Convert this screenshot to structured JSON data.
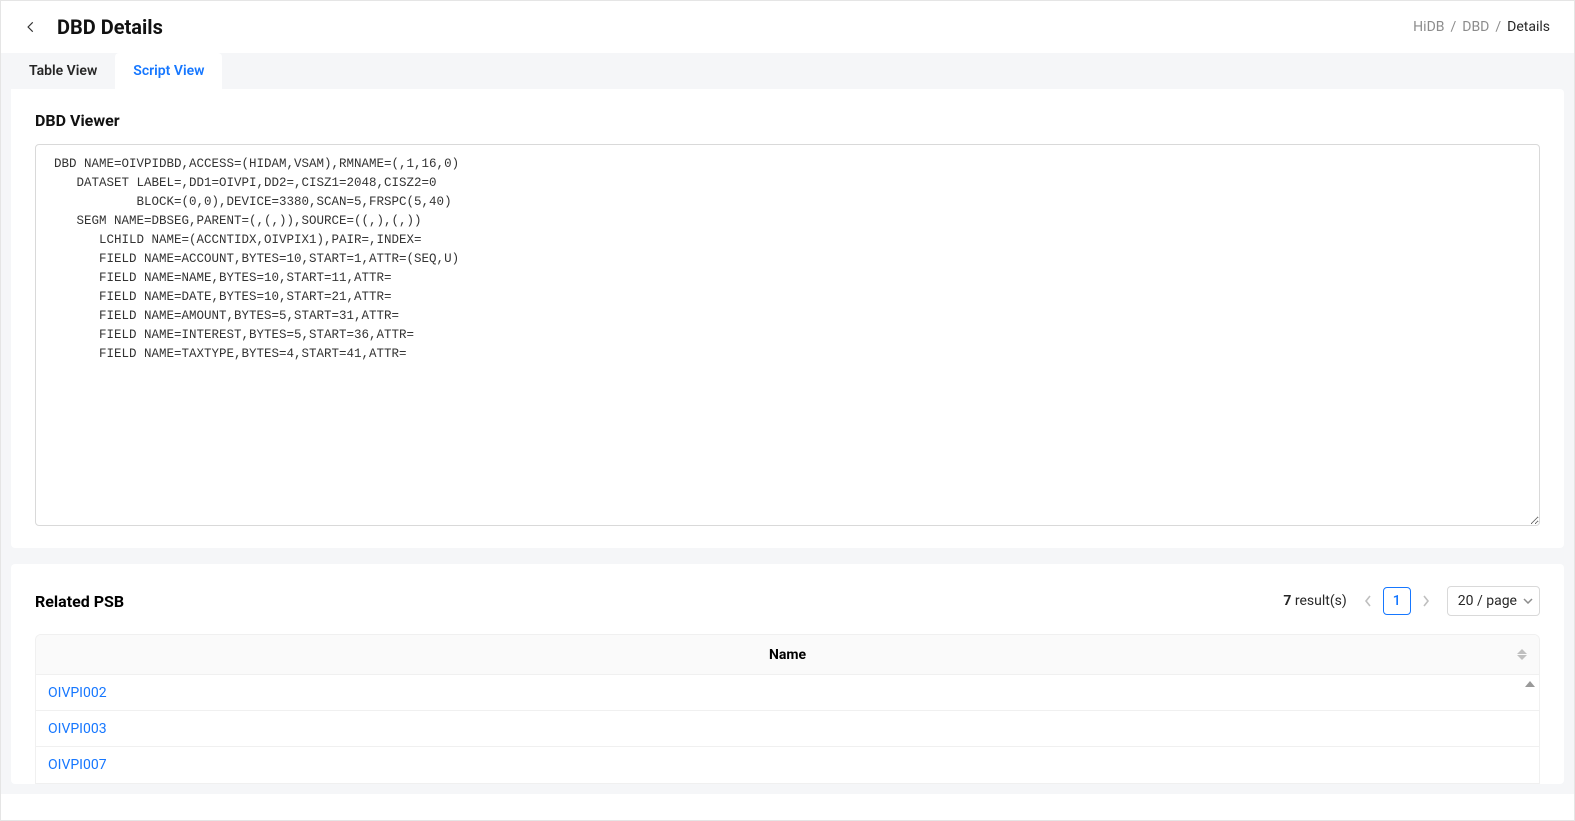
{
  "header": {
    "title": "DBD Details"
  },
  "breadcrumb": {
    "items": [
      "HiDB",
      "DBD",
      "Details"
    ],
    "sep": "/"
  },
  "tabs": {
    "table_view": "Table View",
    "script_view": "Script View"
  },
  "viewer": {
    "title": "DBD Viewer",
    "script": "DBD NAME=OIVPIDBD,ACCESS=(HIDAM,VSAM),RMNAME=(,1,16,0)\n   DATASET LABEL=,DD1=OIVPI,DD2=,CISZ1=2048,CISZ2=0\n           BLOCK=(0,0),DEVICE=3380,SCAN=5,FRSPC(5,40)\n   SEGM NAME=DBSEG,PARENT=(,(,)),SOURCE=((,),(,))\n      LCHILD NAME=(ACCNTIDX,OIVPIX1),PAIR=,INDEX=\n      FIELD NAME=ACCOUNT,BYTES=10,START=1,ATTR=(SEQ,U)\n      FIELD NAME=NAME,BYTES=10,START=11,ATTR=\n      FIELD NAME=DATE,BYTES=10,START=21,ATTR=\n      FIELD NAME=AMOUNT,BYTES=5,START=31,ATTR=\n      FIELD NAME=INTEREST,BYTES=5,START=36,ATTR=\n      FIELD NAME=TAXTYPE,BYTES=4,START=41,ATTR="
  },
  "related_psb": {
    "title": "Related PSB",
    "result_count": "7",
    "result_suffix": " result(s)",
    "page": "1",
    "page_size": "20 / page",
    "column": "Name",
    "rows": [
      "OIVPI002",
      "OIVPI003",
      "OIVPI007"
    ]
  }
}
